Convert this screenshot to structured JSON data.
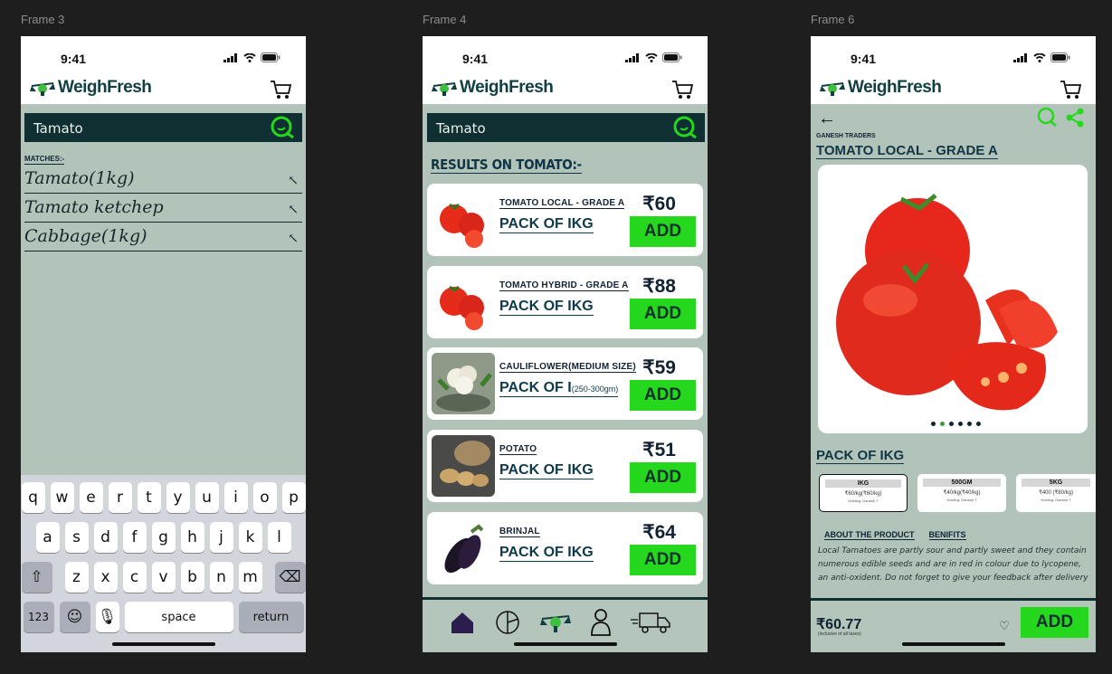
{
  "frames": [
    {
      "label": "Frame 3"
    },
    {
      "label": "Frame 4"
    },
    {
      "label": "Frame 6"
    }
  ],
  "status": {
    "time": "9:41"
  },
  "app": {
    "name": "WeighFresh"
  },
  "search": {
    "query": "Tamato"
  },
  "frame3": {
    "matches_label": "MATCHES:-",
    "suggestions": [
      "Tamato(1kg)",
      "Tamato ketchep",
      "Cabbage(1kg)"
    ],
    "keyboard": {
      "row1": [
        "q",
        "w",
        "e",
        "r",
        "t",
        "y",
        "u",
        "i",
        "o",
        "p"
      ],
      "row2": [
        "a",
        "s",
        "d",
        "f",
        "g",
        "h",
        "j",
        "k",
        "l"
      ],
      "row3": [
        "z",
        "x",
        "c",
        "v",
        "b",
        "n",
        "m"
      ],
      "num_key": "123",
      "space_key": "space",
      "return_key": "return"
    }
  },
  "frame4": {
    "results_title": "RESULTS ON TOMATO:-",
    "products": [
      {
        "name": "TOMATO LOCAL - GRADE A",
        "pack": "PACK OF IKG",
        "pack_note": "",
        "price": "₹60",
        "add": "ADD"
      },
      {
        "name": "TOMATO HYBRID - GRADE A",
        "pack": "PACK OF IKG",
        "pack_note": "",
        "price": "₹88",
        "add": "ADD"
      },
      {
        "name": "CAULIFLOWER(MEDIUM SIZE)",
        "pack": "PACK OF I",
        "pack_note": "(250-300gm)",
        "price": "₹59",
        "add": "ADD"
      },
      {
        "name": "POTATO",
        "pack": "PACK OF IKG",
        "pack_note": "",
        "price": "₹51",
        "add": "ADD"
      },
      {
        "name": "BRINJAL",
        "pack": "PACK OF IKG",
        "pack_note": "",
        "price": "₹64",
        "add": "ADD"
      }
    ]
  },
  "frame6": {
    "seller": "GANESH TRADERS",
    "title": "TOMATO LOCAL - GRADE A",
    "pack_label": "PACK OF IKG",
    "variants": [
      {
        "size": "IKG",
        "price": "₹60/kg(₹60/kg)",
        "note": "Holding: Ganesh T"
      },
      {
        "size": "500GM",
        "price": "₹40/kg(₹40/kg)",
        "note": "Holding: Ganesh T"
      },
      {
        "size": "5KG",
        "price": "₹400 (₹80/kg)",
        "note": "Holding: Ganesh T"
      }
    ],
    "tabs": [
      "ABOUT THE PRODUCT",
      "BENIFITS"
    ],
    "description": "Local Tamatoes are partly sour and partly sweet and they contain numerous edible seeds and are in red in colour due to lycopene, an anti-oxident. Do not forget to give your feedback after delivery",
    "price": "₹60.77",
    "tax_note": "(inclusive of all taxes)",
    "add": "ADD"
  },
  "colors": {
    "accent": "#25d81e",
    "dark": "#0f2f33",
    "bg": "#b2c4ba"
  }
}
